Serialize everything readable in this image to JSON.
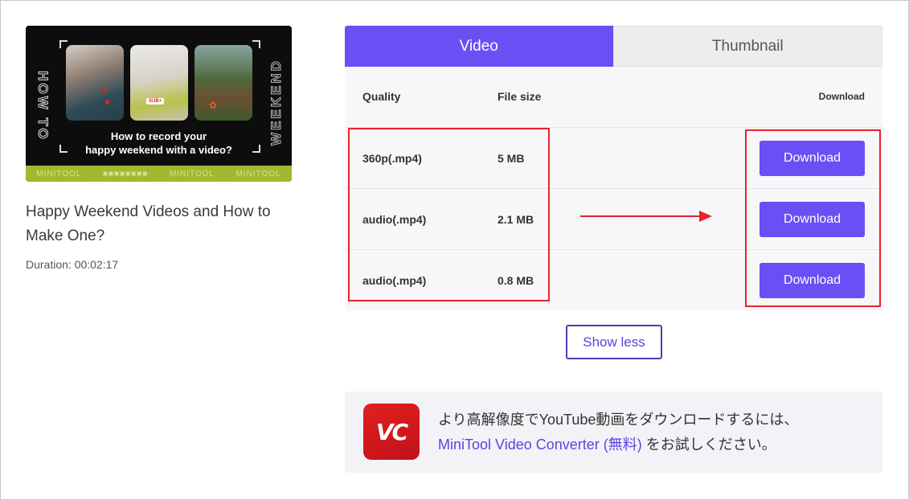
{
  "video": {
    "thumbnail": {
      "side_left": "HOW TO",
      "side_right": "WEEKEND",
      "caption_line1": "How to record your",
      "caption_line2": "happy weekend with a video?",
      "strip_items": [
        "MINITOOL",
        "■■■■■■■■",
        "MINITOOL",
        "MINITOOL"
      ],
      "badge": "SUB+"
    },
    "title": "Happy Weekend Videos and How to Make One?",
    "duration": "Duration: 00:02:17"
  },
  "tabs": [
    {
      "label": "Video",
      "active": true
    },
    {
      "label": "Thumbnail",
      "active": false
    }
  ],
  "table": {
    "headers": {
      "quality": "Quality",
      "file_size": "File size",
      "download": "Download"
    },
    "rows": [
      {
        "quality": "360p(.mp4)",
        "size": "5 MB",
        "button": "Download"
      },
      {
        "quality": "audio(.mp4)",
        "size": "2.1 MB",
        "button": "Download"
      },
      {
        "quality": "audio(.mp4)",
        "size": "0.8 MB",
        "button": "Download"
      }
    ]
  },
  "show_less_label": "Show less",
  "promo": {
    "logo_text": "VC",
    "line1": "より高解像度でYouTube動画をダウンロードするには、",
    "link": "MiniTool Video Converter (無料)",
    "line2_suffix": " をお試しください。"
  },
  "colors": {
    "accent": "#6c4ef5",
    "highlight_red": "#e8232b",
    "logo_red": "#d0171f"
  }
}
